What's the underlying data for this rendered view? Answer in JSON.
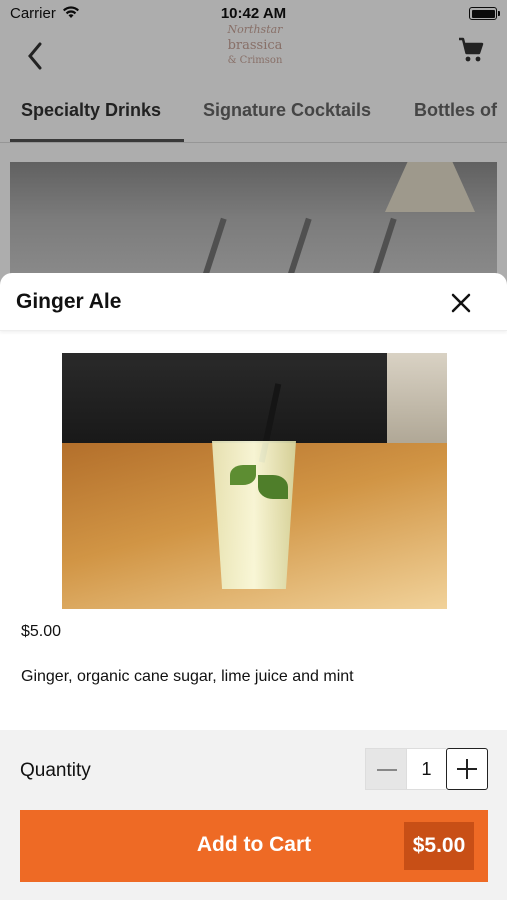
{
  "status_bar": {
    "carrier": "Carrier",
    "time": "10:42 AM"
  },
  "header": {
    "logo_lines": [
      "Northstar",
      "brassica",
      "& Crimson"
    ],
    "icons": {
      "back": "chevron-left-icon",
      "cart": "cart-icon"
    }
  },
  "tabs": [
    {
      "label": "Specialty Drinks",
      "active": true
    },
    {
      "label": "Signature Cocktails",
      "active": false
    },
    {
      "label": "Bottles of",
      "active": false
    }
  ],
  "modal": {
    "title": "Ginger Ale",
    "price": "$5.00",
    "description": "Ginger, organic cane sugar, lime juice and mint",
    "quantity_label": "Quantity",
    "quantity": "1",
    "add_to_cart_label": "Add to Cart",
    "add_to_cart_price": "$5.00"
  },
  "colors": {
    "accent": "#ee6a25",
    "accent_dark": "#c84f16",
    "footer_bg": "#f2f2f2"
  }
}
